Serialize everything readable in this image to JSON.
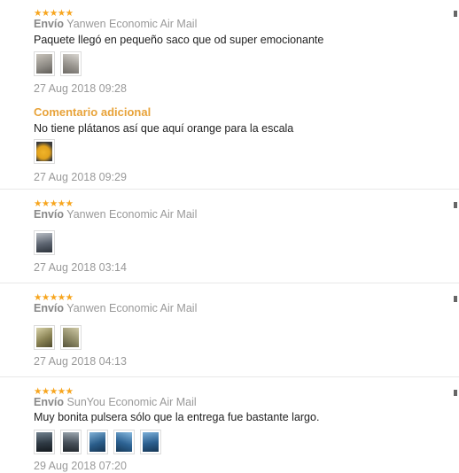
{
  "colors": {
    "star": "#f7a51e",
    "accent_orange": "#e8a33a",
    "muted_text": "#999999",
    "divider": "#e8e8e8"
  },
  "reviews": [
    {
      "stars": "★★★★★",
      "rating": 5,
      "shipping_label": "Envío",
      "shipping_method": "Yanwen Economic Air Mail",
      "text": "Paquete llegó en pequeño saco que od super emocionante",
      "photos": [
        {
          "icon": "photo-thumbnail",
          "color": "#8d8a84",
          "accent": "#c9c4bb"
        },
        {
          "icon": "photo-thumbnail",
          "color": "#9a9690",
          "accent": "#d9d6d1"
        }
      ],
      "date": "27 Aug 2018 09:28",
      "additional": {
        "title": "Comentario adicional",
        "text": "No tiene plátanos así que aquí orange para la escala",
        "photos": [
          {
            "icon": "photo-thumbnail",
            "color": "#e2a21c",
            "accent": "#3a3a3a"
          }
        ],
        "date": "27 Aug 2018 09:29"
      }
    },
    {
      "stars": "★★★★★",
      "rating": 5,
      "shipping_label": "Envío",
      "shipping_method": "Yanwen Economic Air Mail",
      "text": "",
      "photos": [
        {
          "icon": "photo-thumbnail",
          "color": "#5c6470",
          "accent": "#b7bcc3"
        }
      ],
      "date": "27 Aug 2018 03:14"
    },
    {
      "stars": "★★★★★",
      "rating": 5,
      "shipping_label": "Envío",
      "shipping_method": "Yanwen Economic Air Mail",
      "text": "",
      "photos": [
        {
          "icon": "photo-thumbnail",
          "color": "#8b8455",
          "accent": "#d8d2a8"
        },
        {
          "icon": "photo-thumbnail",
          "color": "#8e8a66",
          "accent": "#cfc9a6"
        }
      ],
      "date": "27 Aug 2018 04:13"
    },
    {
      "stars": "★★★★★",
      "rating": 5,
      "shipping_label": "Envío",
      "shipping_method": "SunYou Economic Air Mail",
      "text": "Muy bonita pulsera sólo que la entrega fue bastante largo.",
      "photos": [
        {
          "icon": "photo-thumbnail",
          "color": "#2f3a44",
          "accent": "#6f7f8c"
        },
        {
          "icon": "photo-thumbnail",
          "color": "#47505a",
          "accent": "#9aa5ae"
        },
        {
          "icon": "photo-thumbnail",
          "color": "#2a5d8a",
          "accent": "#7fb0d6"
        },
        {
          "icon": "photo-thumbnail",
          "color": "#2d6394",
          "accent": "#86b8de"
        },
        {
          "icon": "photo-thumbnail",
          "color": "#2b5f8f",
          "accent": "#7aaed8"
        }
      ],
      "date": "29 Aug 2018 07:20"
    }
  ]
}
